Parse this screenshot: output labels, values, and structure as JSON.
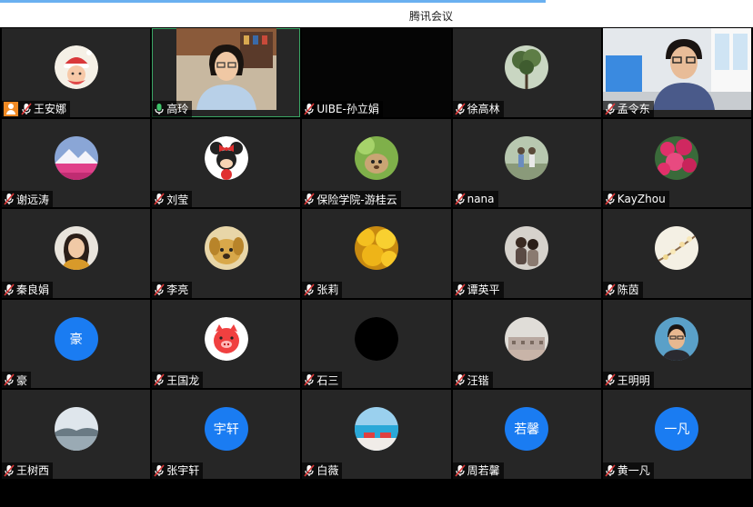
{
  "app": {
    "title": "腾讯会议"
  },
  "colors": {
    "tile_bg": "#262626",
    "avatar_blue": "#1a7cf2",
    "active_border": "#3aa564",
    "host_badge": "#f08a24"
  },
  "participants": [
    {
      "name": "王安娜",
      "avatar": "santa-sticker",
      "host": true
    },
    {
      "name": "高玲",
      "video": "webcam-woman-glasses",
      "active": true
    },
    {
      "name": "UIBE-孙立娟",
      "video": "dark"
    },
    {
      "name": "徐高林",
      "avatar": "tree-photo"
    },
    {
      "name": "孟令东",
      "video": "webcam-man-glasses"
    },
    {
      "name": "谢远涛",
      "avatar": "mountain-photo"
    },
    {
      "name": "刘莹",
      "avatar": "minnie-mouse"
    },
    {
      "name": "保险学院-游桂云",
      "avatar": "cartoon-figure"
    },
    {
      "name": "nana",
      "avatar": "people-photo"
    },
    {
      "name": "KayZhou",
      "avatar": "flowers-photo"
    },
    {
      "name": "秦良娟",
      "avatar": "woman-portrait"
    },
    {
      "name": "李亮",
      "avatar": "puppy-photo"
    },
    {
      "name": "张莉",
      "avatar": "yellow-leaves"
    },
    {
      "name": "谭英平",
      "avatar": "couple-photo"
    },
    {
      "name": "陈茵",
      "avatar": "blossom-photo"
    },
    {
      "name": "豪",
      "initials": "豪"
    },
    {
      "name": "王国龙",
      "avatar": "cartoon-pig"
    },
    {
      "name": "石三",
      "avatar": "black-circle"
    },
    {
      "name": "汪锴",
      "avatar": "building-photo"
    },
    {
      "name": "王明明",
      "avatar": "man-portrait"
    },
    {
      "name": "王树西",
      "avatar": "lake-photo"
    },
    {
      "name": "张宇轩",
      "initials": "宇轩"
    },
    {
      "name": "白薇",
      "avatar": "pool-photo"
    },
    {
      "name": "周若馨",
      "initials": "若馨"
    },
    {
      "name": "黄一凡",
      "initials": "一凡"
    }
  ]
}
